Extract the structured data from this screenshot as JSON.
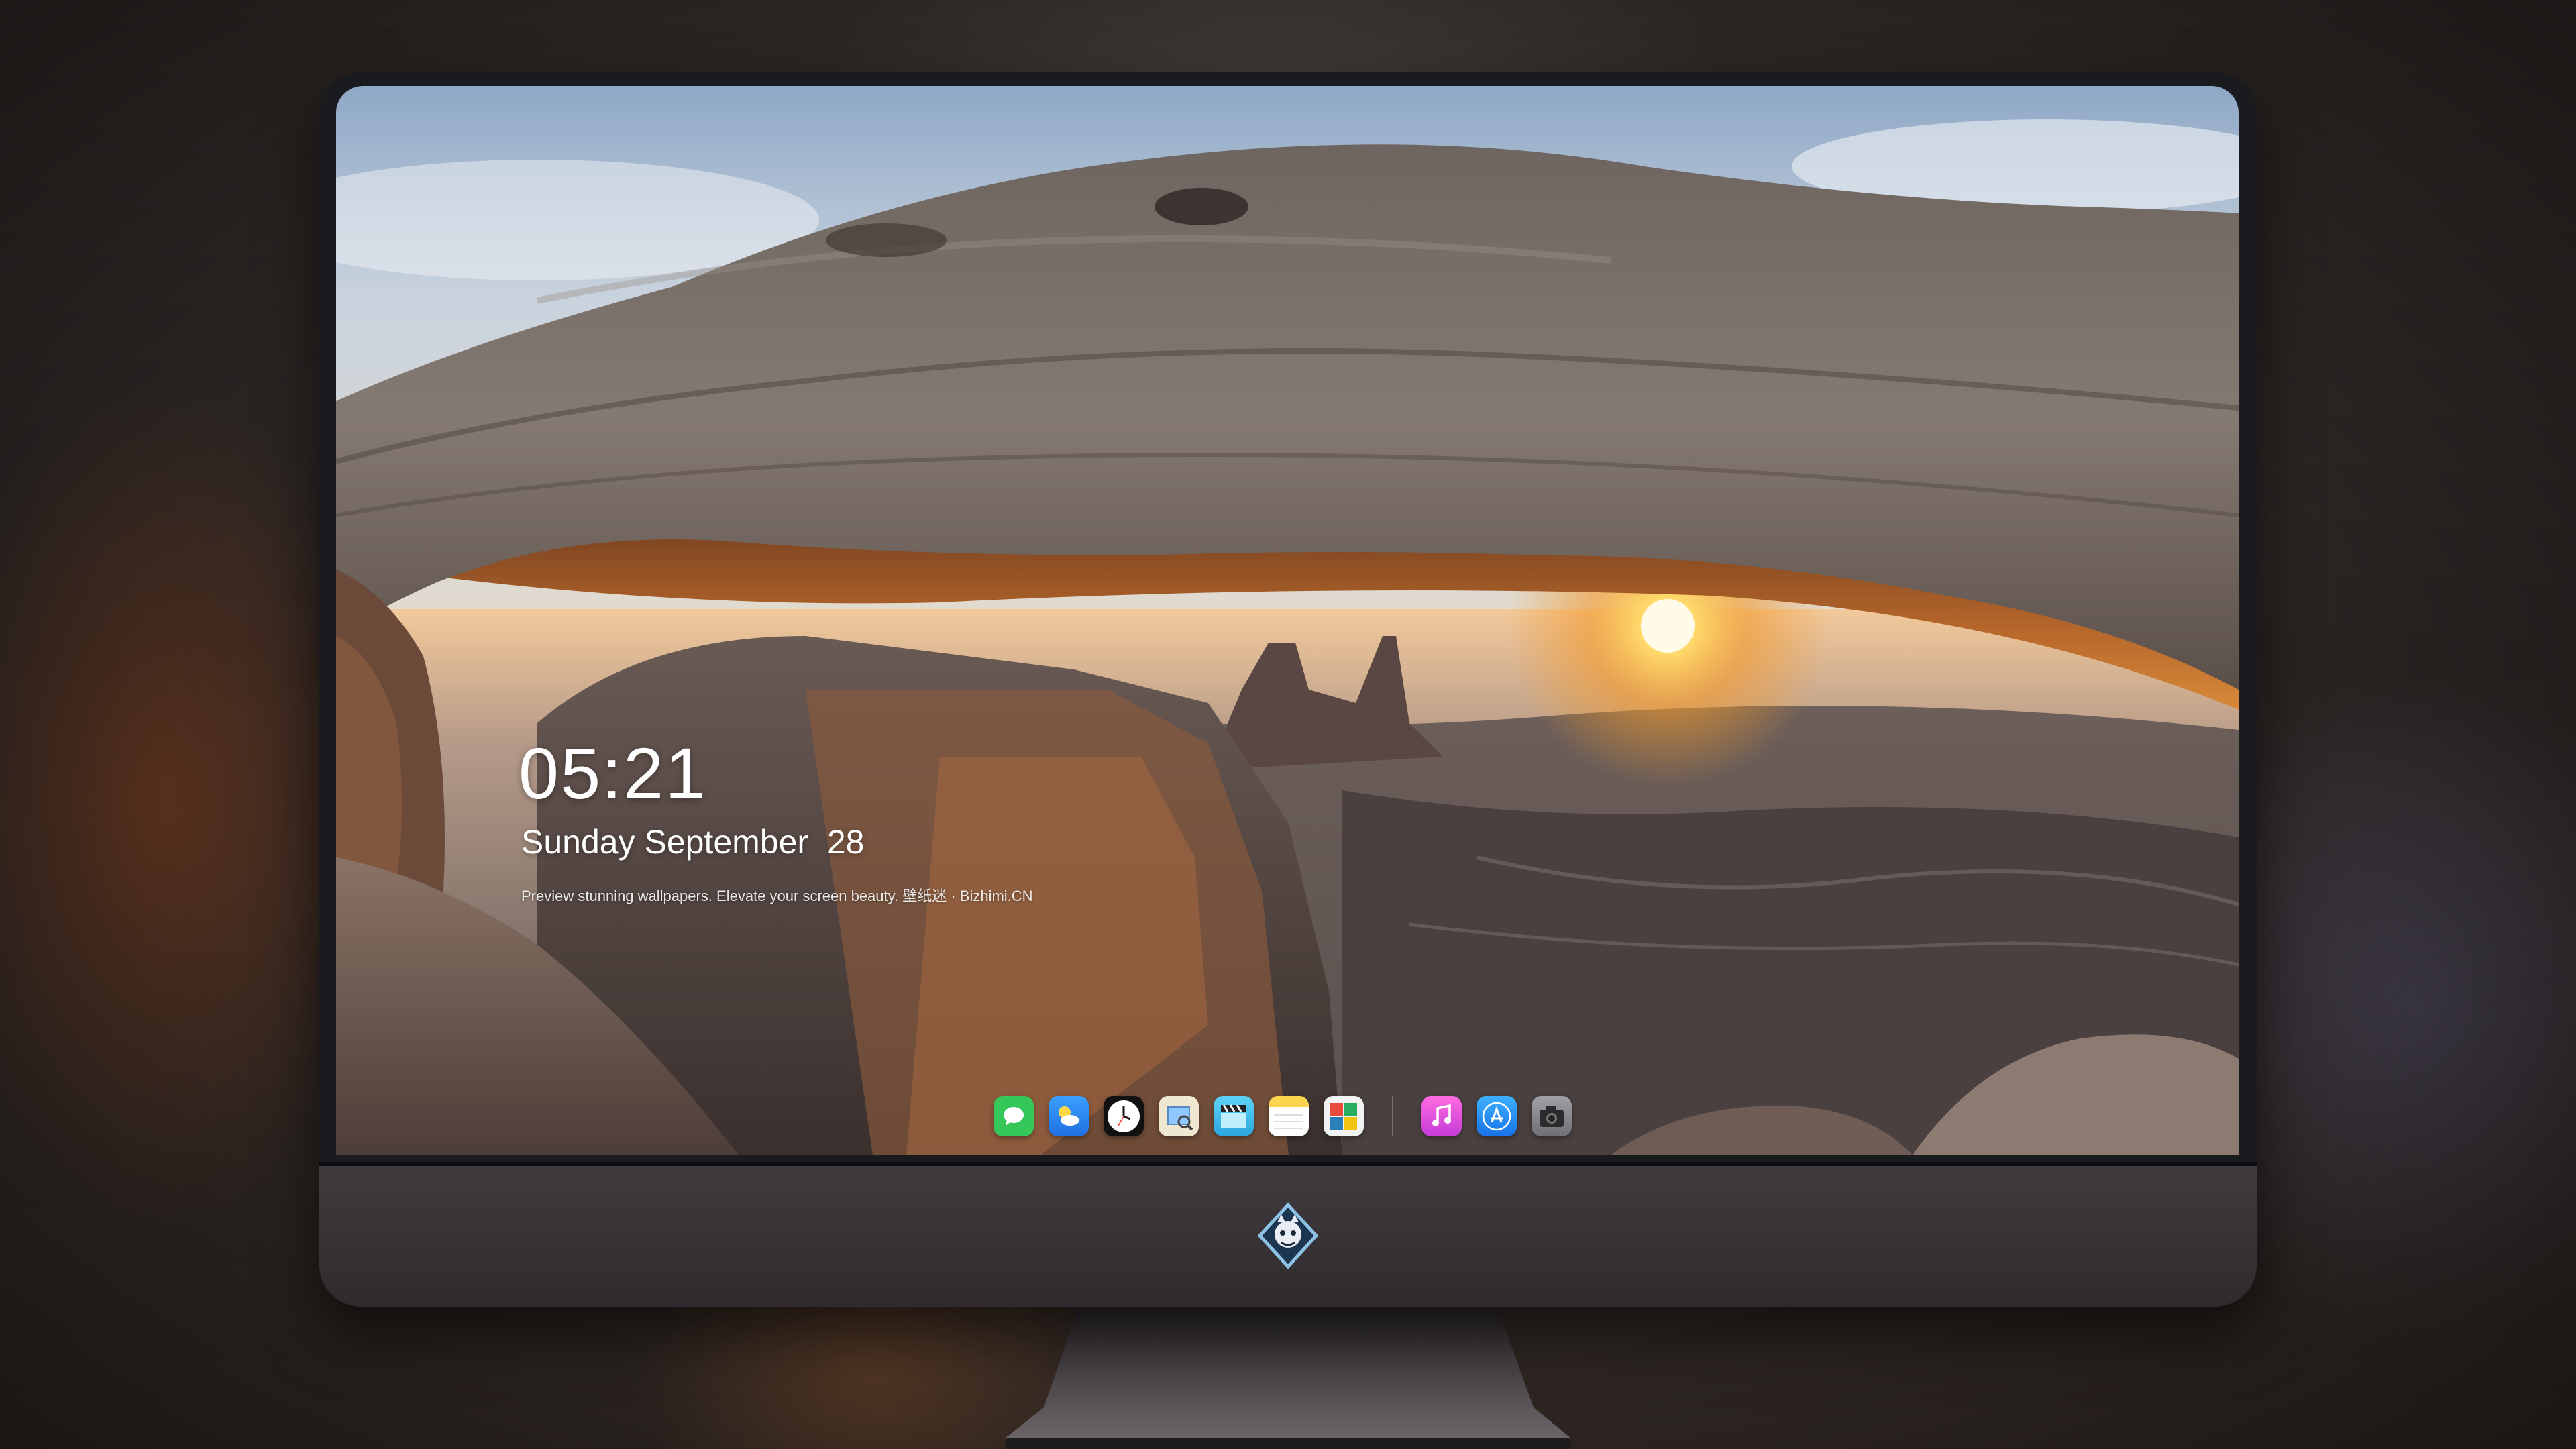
{
  "lock_screen": {
    "time": "05:21",
    "date": "Sunday September  28",
    "caption": "Preview stunning wallpapers. Elevate your screen beauty. 壁纸迷 · Bizhimi.CN"
  },
  "dock": {
    "apps": [
      {
        "name": "messages-icon",
        "color": "#35c759"
      },
      {
        "name": "weather-icon",
        "color": "#2f8ff5"
      },
      {
        "name": "clock-icon",
        "color": "#ffffff"
      },
      {
        "name": "preview-icon",
        "color": "#e9e2c9"
      },
      {
        "name": "video-icon",
        "color": "#3cc0f0"
      },
      {
        "name": "notes-icon",
        "color": "#fbd54d"
      },
      {
        "name": "photo-booth-icon",
        "color": "#f2f2f2"
      },
      {
        "name": "music-icon",
        "color": "#f55bd2"
      },
      {
        "name": "app-store-icon",
        "color": "#1e8cf5"
      },
      {
        "name": "camera-icon",
        "color": "#8e8e93"
      }
    ]
  },
  "colors": {
    "monitor_chin": "#3a3639",
    "bezel": "#1a1b1f",
    "sun": "#ffb83a"
  }
}
